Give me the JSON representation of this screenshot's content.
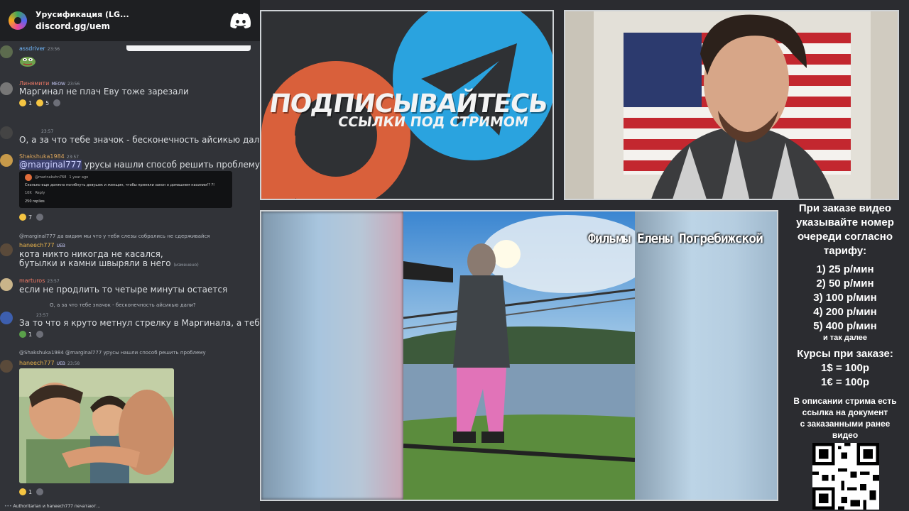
{
  "discord": {
    "server_name": "Урусификация (LG...",
    "invite": "discord.gg/uem",
    "messages": [
      {
        "user": "assdriver",
        "time": "23:56",
        "color": "#70b9ff"
      },
      {
        "user": "Линямити",
        "badge": "MEOW",
        "time": "23:56",
        "color": "#f47b67",
        "text": "Маргинал не плач Еву тоже зарезали",
        "reactions": [
          "1",
          "5"
        ]
      },
      {
        "time": "23:57",
        "text": "О, а за что тебе значок - бесконечность айсикью дали"
      },
      {
        "user": "Shakshuka1984",
        "time": "23:57",
        "color": "#d8a35d",
        "mention": "@marginal777",
        "text": " урусы нашли способ решить проблему",
        "reactions": [
          "7"
        ],
        "embed": {
          "author": "@marinakuhn768",
          "age": "1 year ago",
          "text": "Сколько еще должно погибнуть девушек и женщин, чтобы приняли закон о домашнем насилии!? ?!",
          "likes": "10K",
          "reply": "Reply",
          "replies": "250 replies"
        }
      },
      {
        "reply_to": "@marginal777 да видим мы что у тебя слезы собрались не сдерживайся",
        "user": "haneech777",
        "badge": "UEB",
        "color": "#e9b44c",
        "text_lines": [
          "кота никто никогда не касался,",
          "бутылки и камни швыряли в него"
        ],
        "edited": "(изменено)"
      },
      {
        "user": "marturos",
        "time": "23:57",
        "color": "#f47b67",
        "text": "если не продлить то четыре минуты остается"
      },
      {
        "reply_to": "О, а за что тебе значок - бесконечность айсикью дали?",
        "time": "23:57",
        "text": "За то что я круто метнул стрелку в Маргинала, а тебе?",
        "reactions": [
          "1"
        ]
      },
      {
        "reply_to": "@Shakshuka1984 @marginal777 урусы нашли способ решить проблему",
        "user": "haneech777",
        "badge": "UEB",
        "time": "23:58",
        "color": "#e9b44c",
        "reactions": [
          "1"
        ]
      }
    ],
    "typing": "Authoritarian и haneech777 печатают..."
  },
  "banner": {
    "title": "ПОДПИСЫВАЙТЕСЬ",
    "subtitle": "ССЫЛКИ ПОД СТРИМОМ"
  },
  "video": {
    "caption": "Фильмы Елены Погребижской"
  },
  "info": {
    "intro": [
      "При заказе видео",
      "указывайте номер",
      "очереди согласно",
      "тарифу:"
    ],
    "tariffs": [
      "1) 25 р/мин",
      "2) 50 р/мин",
      "3) 100 р/мин",
      "4) 200 р/мин",
      "5) 400 р/мин"
    ],
    "tariffs_more": "и так далее",
    "courses_title": "Курсы при заказе:",
    "courses": [
      "1$ = 100р",
      "1€ = 100р"
    ],
    "desc": [
      "В описании стрима есть",
      "ссылка на документ",
      "с заказанными ранее",
      "видео"
    ]
  },
  "colors": {
    "chat_bg": "#313338",
    "header_bg": "#1e1f22",
    "telegram_blue": "#2aa3df",
    "patreon_orange": "#e0603a"
  }
}
